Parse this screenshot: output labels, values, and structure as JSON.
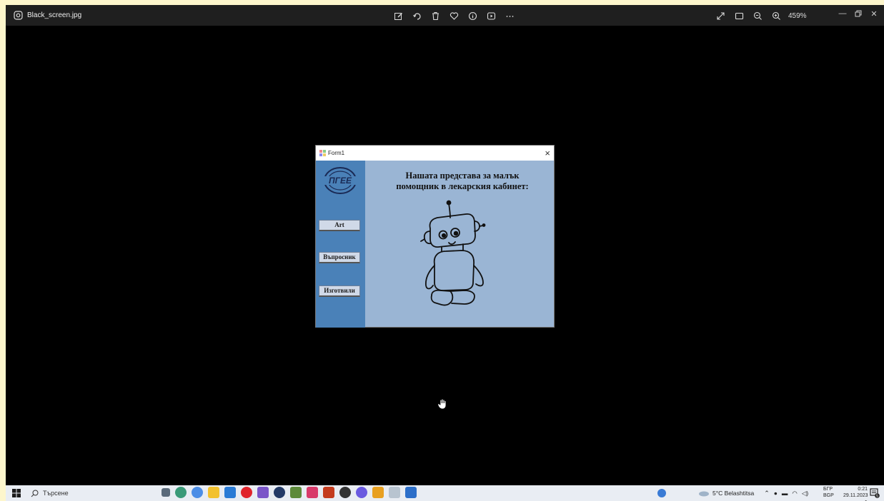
{
  "viewer": {
    "file_name": "Black_screen.jpg",
    "zoom_level": "459%",
    "toolbar_icons": [
      "edit-icon",
      "rotate-icon",
      "delete-icon",
      "favorite-icon",
      "info-icon",
      "slideshow-icon",
      "more-icon"
    ],
    "right_icons": [
      "fullscreen-icon",
      "fit-icon",
      "zoom-out-icon",
      "zoom-in-icon"
    ]
  },
  "form": {
    "title": "Form1",
    "close": "×",
    "heading_line1": "Нашата представа за малък",
    "heading_line2": "помощник в лекарския кабинет:",
    "buttons": [
      {
        "label": "Art"
      },
      {
        "label": "Въпросник"
      },
      {
        "label": "Изготвили"
      }
    ],
    "logo_text": "ПГЕЕ"
  },
  "taskbar": {
    "search_placeholder": "Търсене",
    "weather": "5°C Belashtitsa",
    "lang_top": "БГР",
    "lang_bottom": "BGP",
    "time": "0:21",
    "date": "29.11.2023 г.",
    "notification_count": "5"
  },
  "colors": {
    "form_bg": "#9ab5d4",
    "sidebar_bg": "#4a81b8",
    "taskbar_bg": "#e9edf3"
  }
}
